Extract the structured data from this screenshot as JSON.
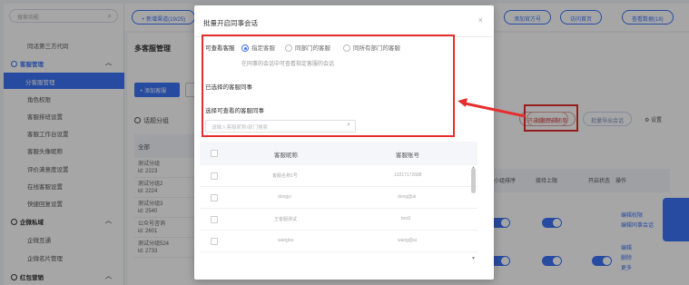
{
  "sidebar": {
    "search_placeholder": "搜索功能",
    "items": [
      {
        "label": "同话第三方代码",
        "type": "sub"
      },
      {
        "label": "客服管理",
        "type": "group"
      },
      {
        "label": "分客服管理",
        "type": "active"
      },
      {
        "label": "角色权限",
        "type": "sub"
      },
      {
        "label": "客服排班设置",
        "type": "sub"
      },
      {
        "label": "客服工作台设置",
        "type": "sub"
      },
      {
        "label": "客服头像昵称",
        "type": "sub"
      },
      {
        "label": "评价满意度设置",
        "type": "sub"
      },
      {
        "label": "在线客服设置",
        "type": "sub"
      },
      {
        "label": "快捷回复设置",
        "type": "sub"
      },
      {
        "label": "企微私域",
        "type": "group"
      },
      {
        "label": "企微互通",
        "type": "sub"
      },
      {
        "label": "企微名片管理",
        "type": "sub"
      },
      {
        "label": "红包营销",
        "type": "group"
      }
    ]
  },
  "topbar": {
    "channel_btn": "+ 新增渠道(19/25)",
    "btn_a": "添加官方号",
    "btn_b": "访问首页",
    "btn_c": "查看数据(18)"
  },
  "content": {
    "page_title": "多客服管理",
    "add_btn": "+ 添加客服",
    "group_label": "话题分组",
    "group_head": "全部",
    "groups": [
      {
        "name": "测试分组",
        "id": "id: 2223"
      },
      {
        "name": "测试分组2",
        "id": "id: 2224"
      },
      {
        "name": "测试分组3",
        "id": "id: 2540"
      },
      {
        "name": "公众号咨询",
        "id": "id: 2601"
      },
      {
        "name": "测试分组524",
        "id": "id: 2733"
      }
    ],
    "tools": [
      "开启自动分配",
      "批量开启同事",
      "批量导出会话",
      "⚙ 设置"
    ],
    "headers": [
      "分配小组排序",
      "接待上限",
      "开启状态",
      "操作"
    ],
    "links": [
      "编辑权限",
      "编辑同事会话",
      "编辑",
      "删除",
      "更多"
    ]
  },
  "modal": {
    "title": "批量开启同事会话",
    "close": "×",
    "view_label": "可查看客服",
    "radios": [
      {
        "label": "指定客服",
        "selected": true
      },
      {
        "label": "同部门的客服",
        "selected": false
      },
      {
        "label": "同所有部门的客服",
        "selected": false
      }
    ],
    "hint": "在同事的会话中可查看指定客服的会话",
    "enabled_label": "已选择的客服同事",
    "choose_label": "选择可查看的客服同事",
    "search_placeholder": "请输入客服昵称/部门搜索",
    "table": {
      "col_name": "客服昵称",
      "col_account": "客服账号",
      "rows": [
        {
          "name": "客服名称1号",
          "account": "13317172688"
        },
        {
          "name": "dongyi",
          "account": "dong@ai"
        },
        {
          "name": "王客服测试",
          "account": "test1"
        },
        {
          "name": "wangbo",
          "account": "wang@ai"
        }
      ]
    }
  },
  "colors": {
    "accent": "#3d74f6",
    "highlight": "#e62e2e"
  }
}
